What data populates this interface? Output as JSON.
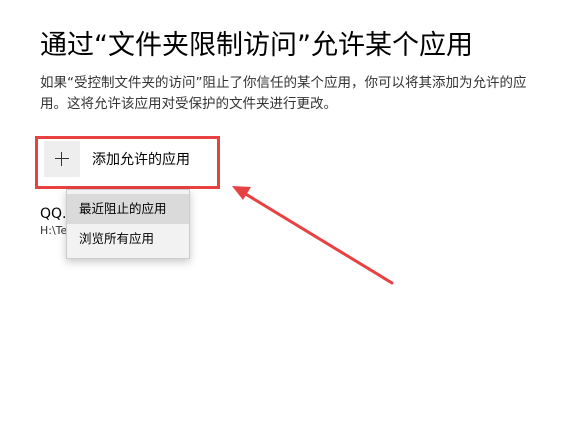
{
  "page": {
    "title": "通过“文件夹限制访问”允许某个应用",
    "description": "如果“受控制文件夹的访问”阻止了你信任的某个应用，你可以将其添加为允许的应用。这将允许该应用对受保护的文件夹进行更改。"
  },
  "add_button": {
    "label": "添加允许的应用",
    "icon": "plus-icon"
  },
  "allowed_app": {
    "name": "QQ.",
    "path": "H:\\Te"
  },
  "dropdown_menu": {
    "items": [
      {
        "label": "最近阻止的应用"
      },
      {
        "label": "浏览所有应用"
      }
    ]
  },
  "annotation": {
    "color": "#e84142"
  }
}
